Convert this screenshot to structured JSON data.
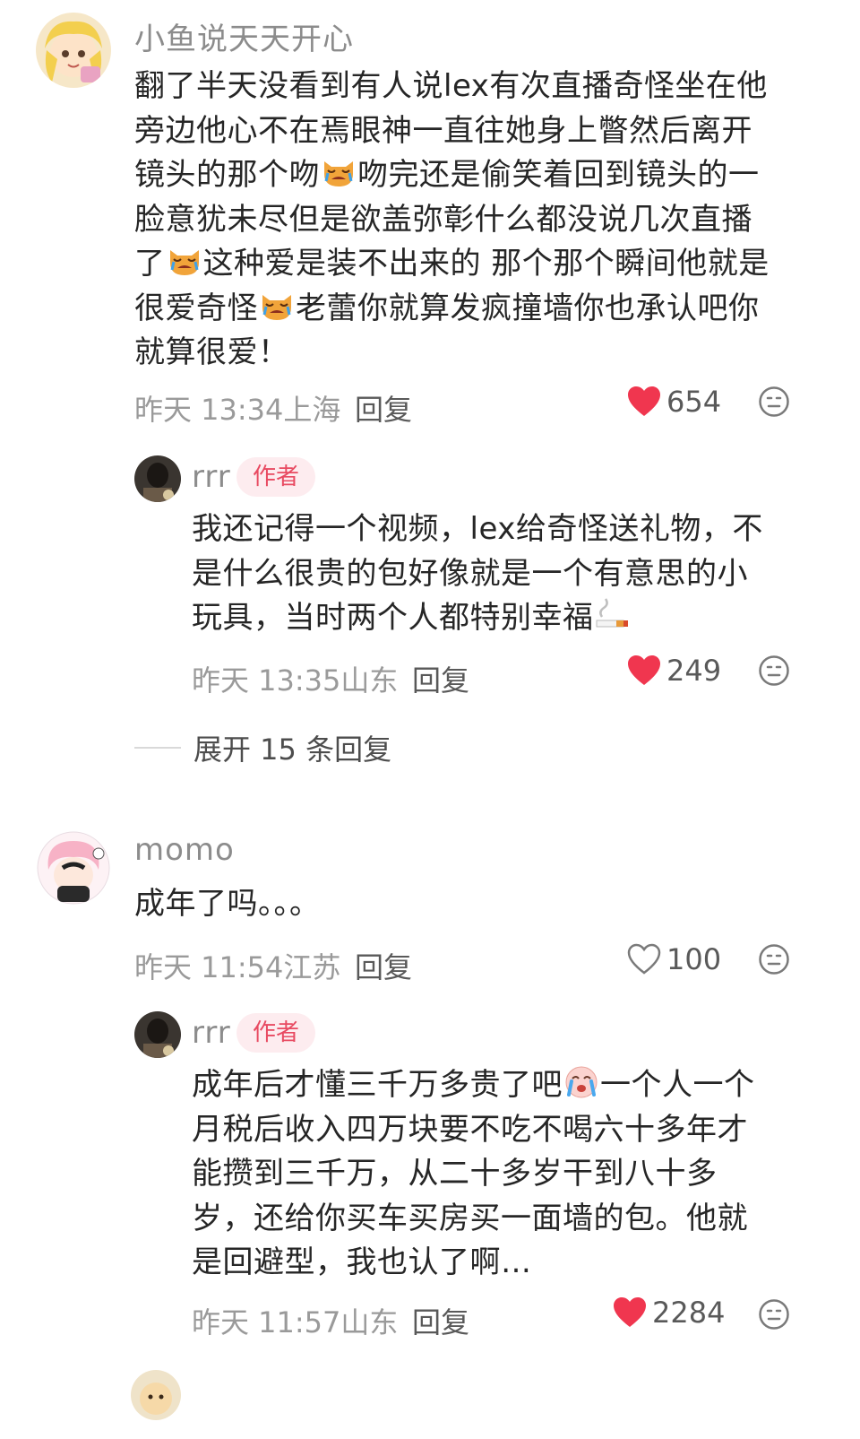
{
  "comments": [
    {
      "username": "小鱼说天天开心",
      "lines": [
        [
          "翻了半天没看到有人说lex有次直播奇怪坐在他"
        ],
        [
          "旁边他心不在焉眼神一直往她身上瞥然后离开"
        ],
        [
          "镜头的那个吻",
          "吻完还是偷笑着回到镜头的一"
        ],
        [
          "脸意犹未尽但是欲盖弥彰什么都没说几次直播"
        ],
        [
          "了",
          "这种爱是装不出来的 那个那个瞬间他就是"
        ],
        [
          "很爱奇怪",
          "老蕾你就算发疯撞墙你也承认吧你"
        ],
        [
          "就算很爱！"
        ]
      ],
      "time": "昨天 13:34",
      "location": "上海",
      "reply_label": "回复",
      "likes": "654",
      "liked": true,
      "replies": [
        {
          "username": "rrr",
          "badge": "作者",
          "lines": [
            [
              "我还记得一个视频，lex给奇怪送礼物，不"
            ],
            [
              "是什么很贵的包好像就是一个有意思的小"
            ],
            [
              "玩具，当时两个人都特别幸福"
            ]
          ],
          "time": "昨天 13:35",
          "location": "山东",
          "reply_label": "回复",
          "likes": "249",
          "liked": true
        }
      ],
      "expand_label": "展开 15 条回复"
    },
    {
      "username": "momo",
      "lines": [
        [
          "成年了吗。。。"
        ]
      ],
      "time": "昨天 11:54",
      "location": "江苏",
      "reply_label": "回复",
      "likes": "100",
      "liked": false,
      "replies": [
        {
          "username": "rrr",
          "badge": "作者",
          "lines": [
            [
              "成年后才懂三千万多贵了吧",
              "一个人一个"
            ],
            [
              "月税后收入四万块要不吃不喝六十多年才"
            ],
            [
              "能攒到三千万，从二十多岁干到八十多"
            ],
            [
              "岁，还给你买车买房买一面墙的包。他就"
            ],
            [
              "是回避型，我也认了啊…"
            ]
          ],
          "time": "昨天 11:57",
          "location": "山东",
          "reply_label": "回复",
          "likes": "2284",
          "liked": true
        }
      ]
    }
  ],
  "colors": {
    "like_red": "#f0364f",
    "badge_bg": "#fdecef",
    "badge_text": "#e84a61",
    "meta_gray": "#9a9a9a"
  },
  "icons": {
    "like": "heart-icon",
    "dislike": "dislike-face-icon",
    "emoji_cat": "crying-cat-emoji",
    "emoji_cigarette": "cigarette-emoji",
    "emoji_crying": "crying-face-emoji"
  }
}
